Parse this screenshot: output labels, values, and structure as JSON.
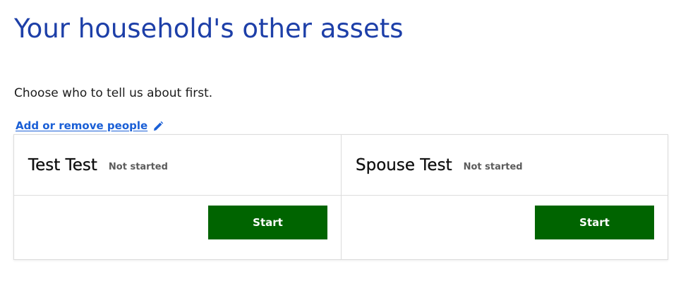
{
  "page": {
    "title": "Your household's other assets",
    "intro": "Choose who to tell us about first."
  },
  "edit_link": {
    "label": "Add or remove people",
    "icon": "pencil-icon"
  },
  "people": [
    {
      "name": "Test Test",
      "status": "Not started",
      "button_label": "Start"
    },
    {
      "name": "Spouse Test",
      "status": "Not started",
      "button_label": "Start"
    }
  ],
  "colors": {
    "title": "#1d3fa8",
    "link": "#1a5fd6",
    "button": "#006400",
    "status": "#5c5c5c",
    "border": "#dcdcdc"
  }
}
